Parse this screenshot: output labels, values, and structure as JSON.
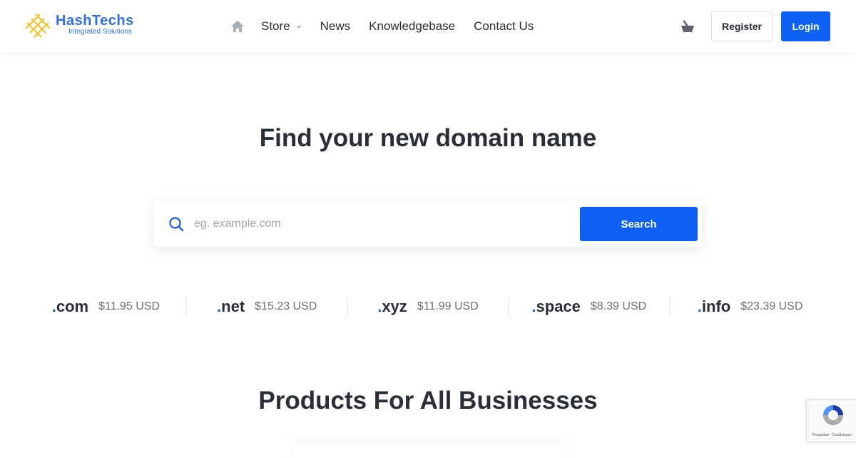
{
  "header": {
    "logo": {
      "name": "HashTechs",
      "tagline": "Integrated Solutions"
    },
    "nav": [
      {
        "label": "Store",
        "has_dropdown": true
      },
      {
        "label": "News"
      },
      {
        "label": "Knowledgebase"
      },
      {
        "label": "Contact Us"
      }
    ],
    "icons": {
      "home": "home-icon",
      "cart": "basket-icon"
    },
    "register_label": "Register",
    "login_label": "Login"
  },
  "hero": {
    "title": "Find your new domain name",
    "search": {
      "placeholder": "eg. example.com",
      "value": "",
      "button_label": "Search"
    }
  },
  "tlds": [
    {
      "dot": ".",
      "ext": "com",
      "price": "$11.95 USD"
    },
    {
      "dot": ".",
      "ext": "net",
      "price": "$15.23 USD"
    },
    {
      "dot": ".",
      "ext": "xyz",
      "price": "$11.99 USD"
    },
    {
      "dot": ".",
      "ext": "space",
      "price": "$8.39 USD"
    },
    {
      "dot": ".",
      "ext": "info",
      "price": "$23.39 USD"
    }
  ],
  "products": {
    "title": "Products For All Businesses"
  },
  "recaptcha": {
    "text": "Privacidad - Condiciones"
  },
  "colors": {
    "accent": "#0d62f5",
    "text": "#2a2e36",
    "muted": "#6c7079",
    "logo_gold": "#f2c230"
  }
}
